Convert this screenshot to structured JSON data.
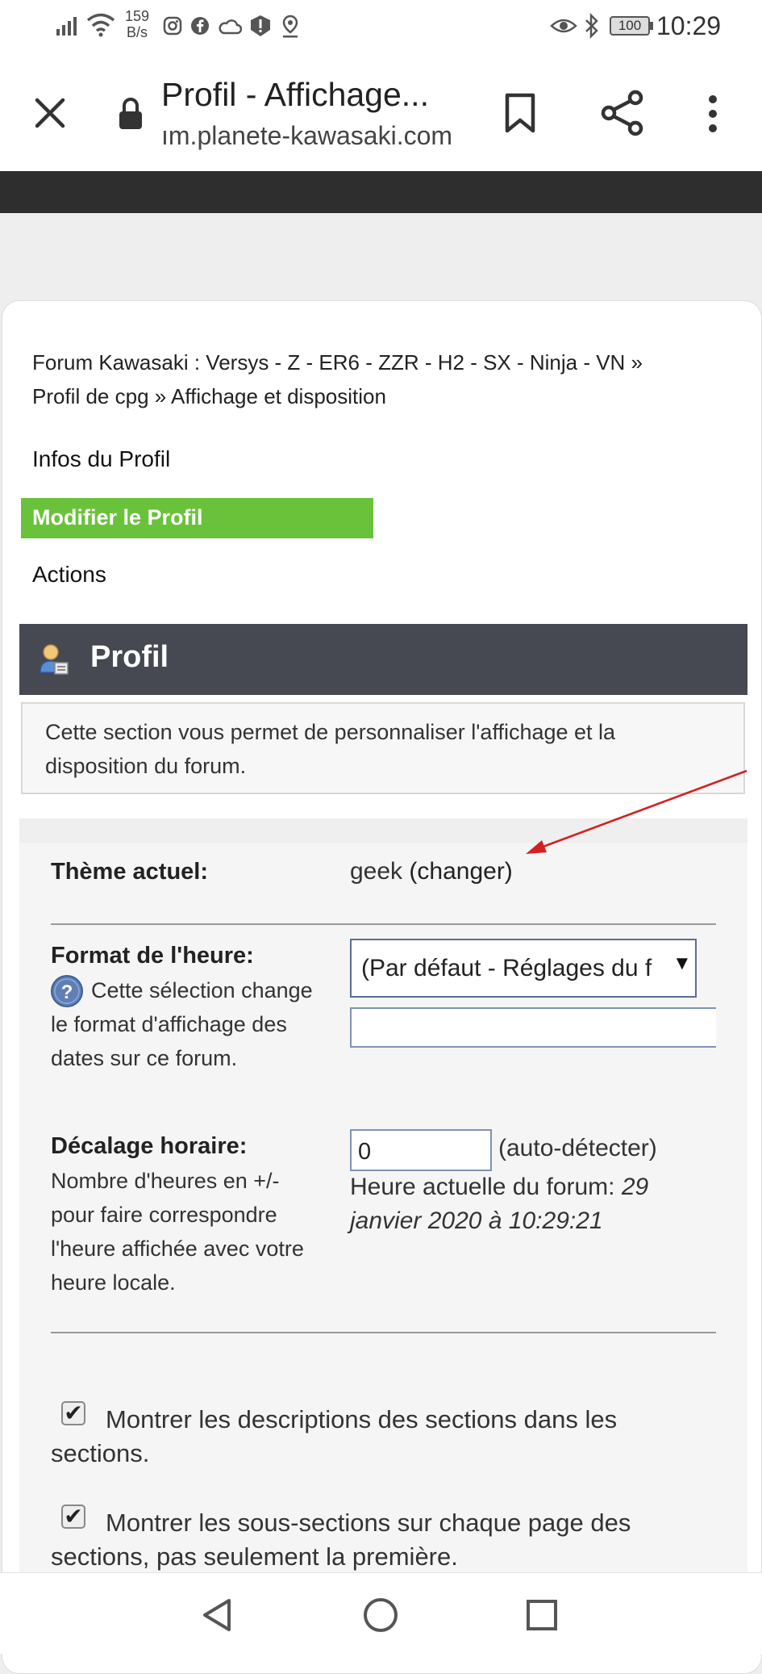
{
  "status_bar": {
    "net_speed_value": "159",
    "net_speed_unit": "B/s",
    "battery": "100",
    "time": "10:29",
    "left_icons": [
      "signal-icon",
      "wifi-icon",
      "instagram-icon",
      "facebook-icon",
      "cloud-icon",
      "alert-icon",
      "location-icon"
    ],
    "right_icons": [
      "eye-icon",
      "bluetooth-icon",
      "battery-icon"
    ]
  },
  "toolbar": {
    "title": "Profil - Affichage...",
    "url": "ım.planete-kawasaki.com"
  },
  "breadcrumb": {
    "line1": "Forum Kawasaki : Versys - Z - ER6 - ZZR - H2 - SX - Ninja - VN »",
    "line2_link": "Profil de cpg",
    "line2_sep": "»",
    "line2_current": "Affichage et disposition"
  },
  "profile_nav": {
    "info": "Infos du Profil",
    "edit": "Modifier le Profil",
    "actions": "Actions"
  },
  "section": {
    "title": "Profil",
    "description": "Cette section vous permet de personnaliser l'affichage et la disposition du forum."
  },
  "theme": {
    "label": "Thème actuel:",
    "value": "geek",
    "change_link": "(changer)"
  },
  "time_format": {
    "label": "Format de l'heure:",
    "help": "Cette sélection change le format d'affichage des dates sur ce forum.",
    "selected": "(Par défaut - Réglages du f",
    "custom_value": ""
  },
  "time_offset": {
    "label": "Décalage horaire:",
    "help": "Nombre d'heures en +/- pour faire correspondre l'heure affichée avec votre heure locale.",
    "value": "0",
    "auto_detect": "(auto-détecter)",
    "current_prefix": "Heure actuelle du forum:",
    "current_value": "29 janvier 2020 à 10:29:21"
  },
  "options": [
    {
      "label": "Montrer les descriptions des sections dans les sections.",
      "checked": true
    },
    {
      "label": "Montrer les sous-sections sur chaque page des sections, pas seulement la première.",
      "checked": true
    }
  ],
  "colors": {
    "accent_green": "#6ac23a",
    "header_dark": "#464852",
    "arrow_red": "#d42020"
  }
}
